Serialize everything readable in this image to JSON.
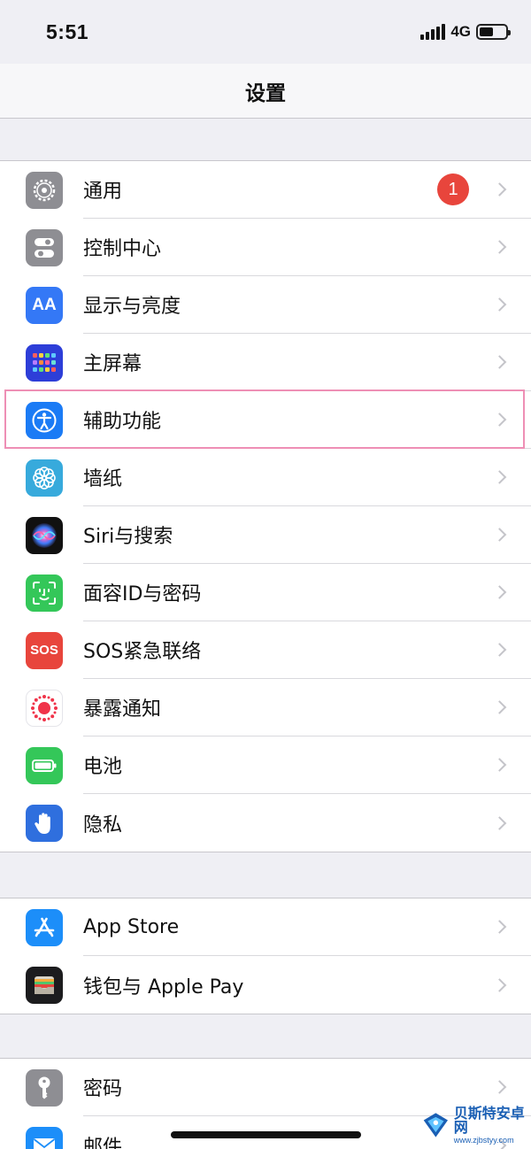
{
  "status": {
    "time": "5:51",
    "network": "4G"
  },
  "nav": {
    "title": "设置"
  },
  "groups": [
    {
      "items": [
        {
          "label": "通用",
          "icon": "gear-icon",
          "color": "#8e8e93",
          "badge": "1"
        },
        {
          "label": "控制中心",
          "icon": "toggles-icon",
          "color": "#8e8e93"
        },
        {
          "label": "显示与亮度",
          "icon": "text-size-icon",
          "color": "#3478f6",
          "glyph": "AA"
        },
        {
          "label": "主屏幕",
          "icon": "app-grid-icon",
          "color": "#2d3ed8"
        },
        {
          "label": "辅助功能",
          "icon": "accessibility-icon",
          "color": "#1b7bf5"
        },
        {
          "label": "墙纸",
          "icon": "flower-icon",
          "color": "#37aadc"
        },
        {
          "label": "Siri与搜索",
          "icon": "siri-icon",
          "color": "#111111"
        },
        {
          "label": "面容ID与密码",
          "icon": "face-id-icon",
          "color": "#34c759"
        },
        {
          "label": "SOS紧急联络",
          "icon": "sos-icon",
          "color": "#e8453c",
          "glyph": "SOS"
        },
        {
          "label": "暴露通知",
          "icon": "exposure-icon",
          "color": "#ffffff"
        },
        {
          "label": "电池",
          "icon": "battery-icon",
          "color": "#34c759"
        },
        {
          "label": "隐私",
          "icon": "hand-icon",
          "color": "#2f6fde"
        }
      ]
    },
    {
      "items": [
        {
          "label": "App Store",
          "icon": "app-store-icon",
          "color": "#1c8ef9"
        },
        {
          "label": "钱包与 Apple Pay",
          "icon": "wallet-icon",
          "color": "#1c1c1e"
        }
      ]
    },
    {
      "items": [
        {
          "label": "密码",
          "icon": "key-icon",
          "color": "#8e8e93"
        },
        {
          "label": "邮件",
          "icon": "mail-icon",
          "color": "#1c8ef9"
        }
      ]
    }
  ],
  "watermark": {
    "title": "贝斯特安卓网",
    "url": "www.zjbstyy.com"
  }
}
